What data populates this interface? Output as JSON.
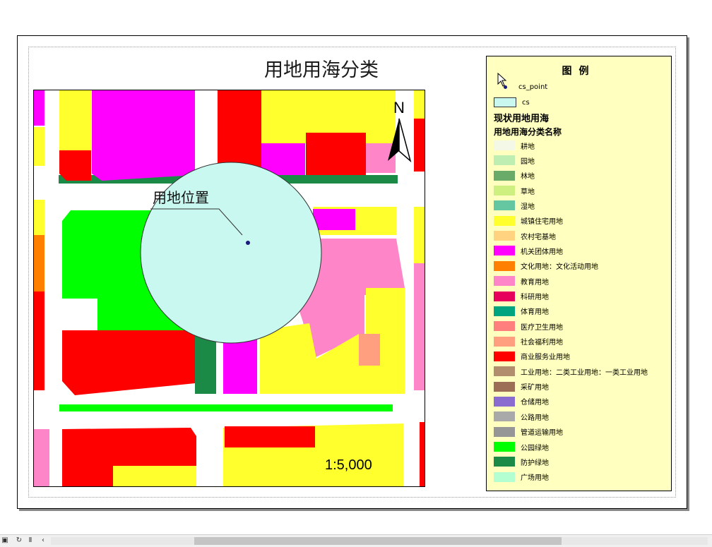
{
  "map": {
    "title": "用地用海分类",
    "scale": "1:5,000",
    "north": "N",
    "site_label": "用地位置"
  },
  "legend": {
    "title": "图例",
    "point_layer": "cs_point",
    "polygon_layer": "cs",
    "layer_heading": "现状用地用海",
    "field_heading": "用地用海分类名称",
    "items": [
      {
        "label": "耕地",
        "color": "#f4f8e6"
      },
      {
        "label": "园地",
        "color": "#bfeeb2"
      },
      {
        "label": "林地",
        "color": "#6aab6a"
      },
      {
        "label": "草地",
        "color": "#cdf080"
      },
      {
        "label": "湿地",
        "color": "#65c6a2"
      },
      {
        "label": "城镇住宅用地",
        "color": "#ffff2d"
      },
      {
        "label": "农村宅基地",
        "color": "#ffd380"
      },
      {
        "label": "机关团体用地",
        "color": "#ff00ff"
      },
      {
        "label": "文化用地：文化活动用地",
        "color": "#ff7f00"
      },
      {
        "label": "教育用地",
        "color": "#ff85c9"
      },
      {
        "label": "科研用地",
        "color": "#e6005c"
      },
      {
        "label": "体育用地",
        "color": "#00a57f"
      },
      {
        "label": "医疗卫生用地",
        "color": "#ff7f7f"
      },
      {
        "label": "社会福利用地",
        "color": "#ff9f7f"
      },
      {
        "label": "商业服务业用地",
        "color": "#ff0000"
      },
      {
        "label": "工业用地：二类工业用地：一类工业用地",
        "color": "#b38e6e"
      },
      {
        "label": "采矿用地",
        "color": "#9c6e55"
      },
      {
        "label": "仓储用地",
        "color": "#8a6bcf"
      },
      {
        "label": "公路用地",
        "color": "#a9a9a9"
      },
      {
        "label": "管道运输用地",
        "color": "#969696"
      },
      {
        "label": "公园绿地",
        "color": "#00ff00"
      },
      {
        "label": "防护绿地",
        "color": "#1b8a46"
      },
      {
        "label": "广场用地",
        "color": "#b4ffd2"
      }
    ]
  },
  "colors": {
    "residential": "#ffff2d",
    "commercial": "#ff0000",
    "institution": "#ff00ff",
    "education": "#ff85c9",
    "park": "#00ff00",
    "protective": "#1b8a46",
    "culture": "#ff7f00",
    "buffer": "#c8f8f0",
    "legend_bg": "#ffffc0"
  }
}
